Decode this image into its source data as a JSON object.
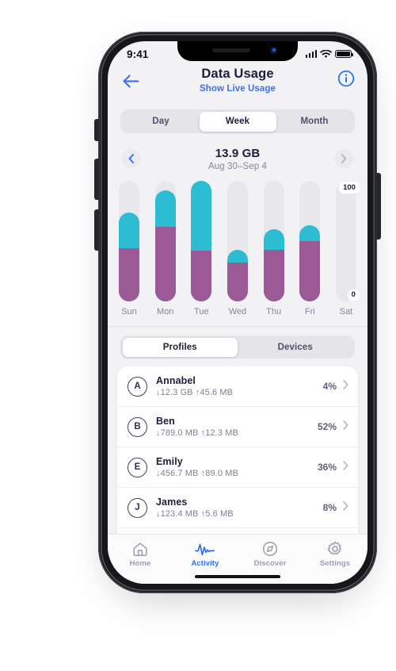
{
  "status_bar": {
    "clock": "9:41",
    "signal_icon": "cellular-signal-icon",
    "wifi_icon": "wifi-icon",
    "battery_icon": "battery-full-icon"
  },
  "nav": {
    "back_icon": "back-arrow-icon",
    "title": "Data Usage",
    "live_link": "Show Live Usage",
    "info_icon": "info-circle-icon"
  },
  "range_tabs": [
    {
      "label": "Day",
      "active": false
    },
    {
      "label": "Week",
      "active": true
    },
    {
      "label": "Month",
      "active": false
    }
  ],
  "period": {
    "prev_icon": "chevron-left-icon",
    "next_icon": "chevron-right-icon",
    "total": "13.9 GB",
    "range": "Aug 30–Sep 4"
  },
  "chart_data": {
    "type": "bar",
    "title": "",
    "xlabel": "",
    "ylabel": "",
    "ylim": [
      0,
      100
    ],
    "grid": false,
    "stacked": true,
    "axis_labels": {
      "max": "100",
      "min": "0"
    },
    "categories": [
      "Sun",
      "Mon",
      "Tue",
      "Wed",
      "Thu",
      "Fri",
      "Sat"
    ],
    "series": [
      {
        "name": "download",
        "color": "#9b5a96",
        "values": [
          44,
          62,
          42,
          32,
          43,
          50,
          0
        ]
      },
      {
        "name": "upload",
        "color": "#2cbdd3",
        "values": [
          30,
          30,
          58,
          11,
          17,
          13,
          0
        ]
      }
    ],
    "totals": [
      74,
      92,
      100,
      43,
      60,
      63,
      0
    ],
    "track_color": "#e7e7ec"
  },
  "list_tabs": [
    {
      "label": "Profiles",
      "active": true
    },
    {
      "label": "Devices",
      "active": false
    }
  ],
  "profiles": [
    {
      "initial": "A",
      "name": "Annabel",
      "usage": "↓12.3 GB ↑45.6 MB",
      "percent": "4%",
      "chevron": "chevron-right-icon"
    },
    {
      "initial": "B",
      "name": "Ben",
      "usage": "↓789.0 MB ↑12.3 MB",
      "percent": "52%",
      "chevron": "chevron-right-icon"
    },
    {
      "initial": "E",
      "name": "Emily",
      "usage": "↓456.7 MB ↑89.0 MB",
      "percent": "36%",
      "chevron": "chevron-right-icon"
    },
    {
      "initial": "J",
      "name": "James",
      "usage": "↓123.4 MB ↑5.6 MB",
      "percent": "8%",
      "chevron": "chevron-right-icon"
    }
  ],
  "tab_bar": [
    {
      "label": "Home",
      "icon": "home-icon",
      "active": false
    },
    {
      "label": "Activity",
      "icon": "pulse-icon",
      "active": true
    },
    {
      "label": "Discover",
      "icon": "compass-icon",
      "active": false
    },
    {
      "label": "Settings",
      "icon": "gear-icon",
      "active": false
    }
  ],
  "colors": {
    "accent_blue": "#3d6ef5",
    "upload_cyan": "#2cbdd3",
    "download_purple": "#9b5a96",
    "text_dark": "#1b1f3b",
    "text_muted": "#83869c"
  }
}
